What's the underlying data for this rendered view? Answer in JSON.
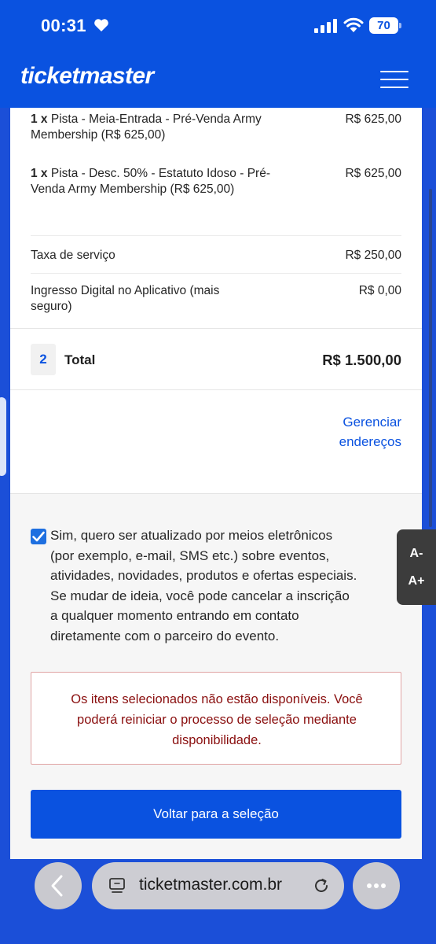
{
  "status_bar": {
    "time": "00:31",
    "battery": "70"
  },
  "header": {
    "logo": "ticketmaster"
  },
  "order": {
    "items": [
      {
        "qty": "1 x",
        "description": "Pista - Meia-Entrada - Pré-Venda Army Membership (R$ 625,00)",
        "price": "R$ 625,00"
      },
      {
        "qty": "1 x",
        "description": "Pista - Desc. 50% - Estatuto Idoso - Pré-Venda Army Membership (R$ 625,00)",
        "price": "R$ 625,00"
      }
    ],
    "fees": [
      {
        "description": "Taxa de serviço",
        "price": "R$ 250,00"
      },
      {
        "description": "Ingresso Digital no Aplicativo (mais seguro)",
        "price": "R$ 0,00"
      }
    ],
    "total": {
      "count": "2",
      "label": "Total",
      "value": "R$ 1.500,00"
    }
  },
  "manage_addresses": {
    "line1": "Gerenciar",
    "line2": "endereços"
  },
  "consent": {
    "checked": true,
    "lines": [
      "Sim, quero ser atualizado por meios eletrônicos",
      "(por exemplo, e-mail, SMS etc.) sobre eventos,",
      "atividades, novidades, produtos e ofertas especiais.",
      "Se mudar de ideia, você pode cancelar a inscrição",
      "a qualquer momento entrando em contato",
      "diretamente com o parceiro do evento."
    ]
  },
  "alert": {
    "lines": [
      "Os itens selecionados não estão disponíveis. Você",
      "poderá reiniciar o processo de seleção mediante",
      "disponibilidade."
    ]
  },
  "primary_button": "Voltar para a seleção",
  "font_widget": {
    "decrease": "A-",
    "increase": "A+"
  },
  "browser": {
    "url": "ticketmaster.com.br"
  },
  "colors": {
    "brand": "#0a52e0",
    "alert_text": "#8a0f0f",
    "alert_border": "#e0a4a4"
  }
}
